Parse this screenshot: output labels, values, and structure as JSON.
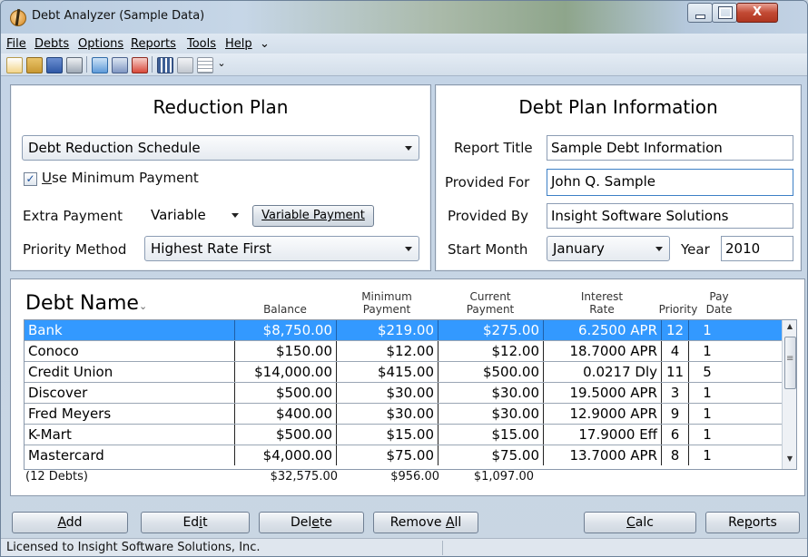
{
  "window": {
    "title": "Debt Analyzer  (Sample Data)",
    "close_label": "X"
  },
  "menu": [
    {
      "label": "File"
    },
    {
      "label": "Debts"
    },
    {
      "label": "Options"
    },
    {
      "label": "Reports"
    },
    {
      "label": "Tools"
    },
    {
      "label": "Help"
    },
    {
      "label": "⌄"
    }
  ],
  "toolbar_icons": [
    "new-file-icon",
    "open-folder-icon",
    "save-icon",
    "print-icon",
    "add-debt-icon",
    "edit-icon",
    "delete-icon",
    "grid-icon",
    "report-icon",
    "document-icon"
  ],
  "reduction": {
    "title": "Reduction Plan",
    "schedule": "Debt Reduction Schedule",
    "use_minimum_prefix": "U",
    "use_minimum_rest": "se Minimum Payment",
    "use_minimum_checked": true,
    "extra_payment_label": "Extra Payment",
    "extra_payment_value": "Variable",
    "variable_payment_button": "Variable Payment",
    "priority_label": "Priority Method",
    "priority_value": "Highest Rate First"
  },
  "info": {
    "title": "Debt Plan Information",
    "report_title_label": "Report Title",
    "report_title_value": "Sample Debt Information",
    "provided_for_label": "Provided For",
    "provided_for_value": "John Q. Sample",
    "provided_by_label": "Provided By",
    "provided_by_value": "Insight Software Solutions",
    "start_month_label": "Start Month",
    "start_month_value": "January",
    "year_label": "Year",
    "year_value": "2010"
  },
  "grid": {
    "headers": {
      "name": "Debt Name",
      "balance": "Balance",
      "minimum_1": "Minimum",
      "minimum_2": "Payment",
      "current_1": "Current",
      "current_2": "Payment",
      "rate_1": "Interest",
      "rate_2": "Rate",
      "priority": "Priority",
      "pay_1": "Pay",
      "pay_2": "Date"
    },
    "rows": [
      {
        "name": "Bank",
        "balance": "$8,750.00",
        "minimum": "$219.00",
        "current": "$275.00",
        "rate": "6.2500 APR",
        "priority": "12",
        "pay_date": "1"
      },
      {
        "name": "Conoco",
        "balance": "$150.00",
        "minimum": "$12.00",
        "current": "$12.00",
        "rate": "18.7000 APR",
        "priority": "4",
        "pay_date": "1"
      },
      {
        "name": "Credit Union",
        "balance": "$14,000.00",
        "minimum": "$415.00",
        "current": "$500.00",
        "rate": "0.0217 Dly",
        "priority": "11",
        "pay_date": "5"
      },
      {
        "name": "Discover",
        "balance": "$500.00",
        "minimum": "$30.00",
        "current": "$30.00",
        "rate": "19.5000 APR",
        "priority": "3",
        "pay_date": "1"
      },
      {
        "name": "Fred Meyers",
        "balance": "$400.00",
        "minimum": "$30.00",
        "current": "$30.00",
        "rate": "12.9000 APR",
        "priority": "9",
        "pay_date": "1"
      },
      {
        "name": "K-Mart",
        "balance": "$500.00",
        "minimum": "$15.00",
        "current": "$15.00",
        "rate": "17.9000 Eff",
        "priority": "6",
        "pay_date": "1"
      },
      {
        "name": "Mastercard",
        "balance": "$4,000.00",
        "minimum": "$75.00",
        "current": "$75.00",
        "rate": "13.7000 APR",
        "priority": "8",
        "pay_date": "1"
      }
    ],
    "totals": {
      "count": "(12 Debts)",
      "balance": "$32,575.00",
      "minimum": "$956.00",
      "current": "$1,097.00"
    }
  },
  "buttons": {
    "add_u": "A",
    "add_rest": "dd",
    "edit_pre": "Ed",
    "edit_u": "i",
    "edit_rest": "t",
    "delete_pre": "Del",
    "delete_u": "e",
    "delete_rest": "te",
    "remove_all_pre": "Remove ",
    "remove_all_u": "A",
    "remove_all_rest": "ll",
    "calc_u": "C",
    "calc_rest": "alc",
    "reports_pre": "Re",
    "reports_u": "p",
    "reports_rest": "orts"
  },
  "status": {
    "text": "Licensed to Insight Software Solutions, Inc."
  }
}
